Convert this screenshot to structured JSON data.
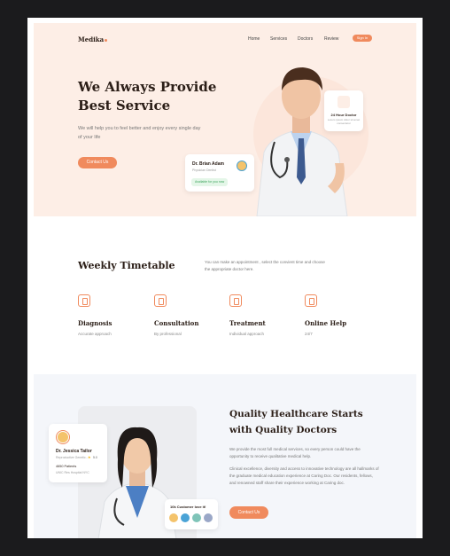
{
  "brand": {
    "name": "Medika"
  },
  "nav": {
    "items": [
      "Home",
      "Services",
      "Doctors",
      "Review"
    ],
    "signin": "Sign In"
  },
  "hero": {
    "title_line1": "We Always Provide",
    "title_line2": "Best Service",
    "subtitle": "We will help you to feel better and enjoy every single day of your life",
    "cta": "Contact Us",
    "support_card": {
      "title": "24 Hour Doctor",
      "text": "Lorem ipsum dolor sit amet consectetur"
    },
    "doctor_card": {
      "name": "Dr. Brian Adam",
      "role": "Physician Dentist",
      "status": "Available for you now"
    }
  },
  "timetable": {
    "title": "Weekly Timetable",
    "description": "You can make an appointment , select the convient time and choose the appropriate doctor here.",
    "features": [
      {
        "title": "Diagnosis",
        "desc": "Accurate approach",
        "icon": "clipboard-icon"
      },
      {
        "title": "Consultation",
        "desc": "By professional",
        "icon": "doctor-icon"
      },
      {
        "title": "Treatment",
        "desc": "Individual approach",
        "icon": "heart-monitor-icon"
      },
      {
        "title": "Online Help",
        "desc": "24/7",
        "icon": "online-help-icon"
      }
    ]
  },
  "quality": {
    "title_line1": "Quality Healthcare Starts",
    "title_line2": "with Quality Doctors",
    "para1": "We provide the most full medical services, so every person could have the opportunity to receive qualitative medical help.",
    "para2": "Clinical excellence, diversity and access to innovative technology are all hallmarks of the graduate medical education experience at Caring Doc. Our residents, fellows, and renowned staff share their experience working at Caring doc.",
    "cta": "Contact Us",
    "doctor_card": {
      "name": "Dr. Jessica Tailor",
      "role": "Reproductive Genetic...",
      "rating": "5.0",
      "patients": "4650 Patients",
      "hospital": "UNIC Res Hospital NYC"
    },
    "customers": {
      "label": "10k Customer love it!"
    }
  },
  "colors": {
    "accent": "#f08a5d",
    "hero_bg": "#fdeee6",
    "heading": "#2b1e17"
  }
}
